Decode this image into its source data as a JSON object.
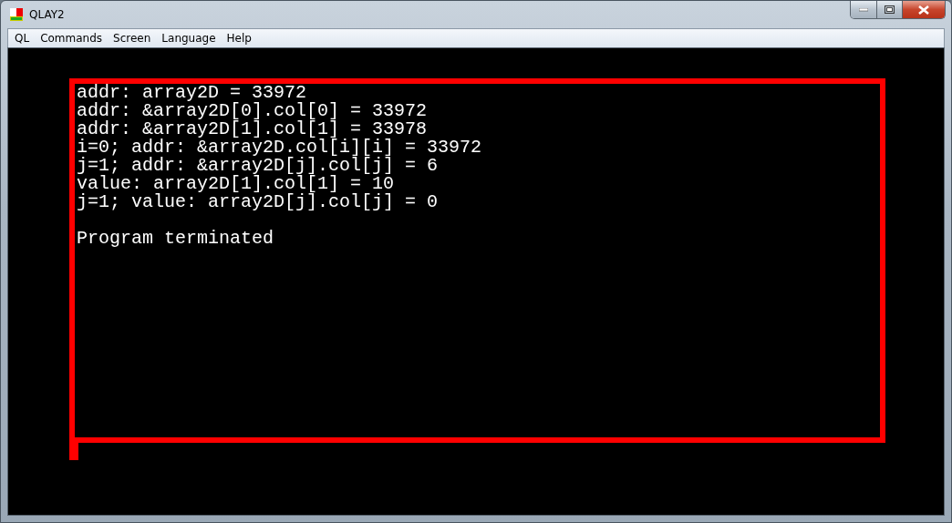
{
  "window": {
    "title": "QLAY2"
  },
  "menu": [
    "QL",
    "Commands",
    "Screen",
    "Language",
    "Help"
  ],
  "console": {
    "output_lines": [
      "addr: array2D = 33972",
      "addr: &array2D[0].col[0] = 33972",
      "addr: &array2D[1].col[1] = 33978",
      "i=0; addr: &array2D.col[i][i] = 33972",
      "j=1; addr: &array2D[j].col[j] = 6",
      "value: array2D[1].col[1] = 10",
      "j=1; value: array2D[j].col[j] = 0"
    ],
    "status_line": "Program terminated"
  }
}
